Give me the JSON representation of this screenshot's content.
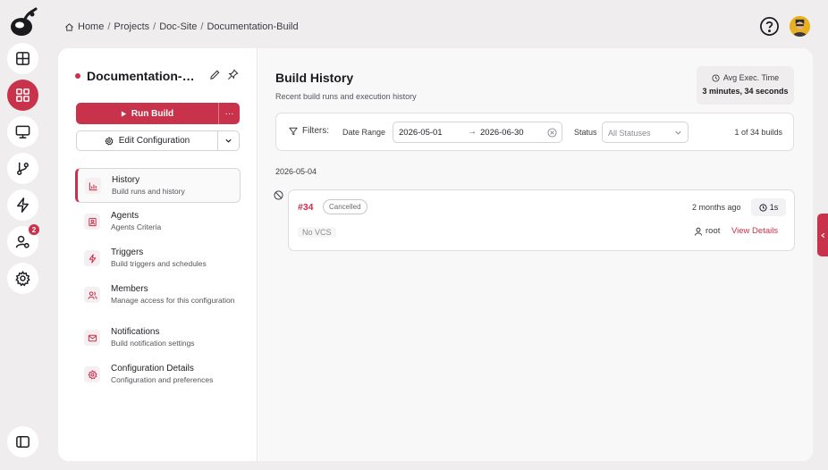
{
  "breadcrumb": {
    "items": [
      "Home",
      "Projects",
      "Doc-Site",
      "Documentation-Build"
    ],
    "separator": "/"
  },
  "rail": {
    "items": [
      {
        "icon": "layout-icon",
        "active": false
      },
      {
        "icon": "grid-icon",
        "active": true
      },
      {
        "icon": "monitor-icon",
        "active": false
      },
      {
        "icon": "git-branch-icon",
        "active": false
      },
      {
        "icon": "zap-icon",
        "active": false
      },
      {
        "icon": "user-cog-icon",
        "active": false,
        "badge": "2"
      },
      {
        "icon": "gear-icon",
        "active": false
      }
    ],
    "bottom_icon": "sidebar-toggle-icon"
  },
  "config": {
    "title": "Documentation-Build",
    "run_label": "Run Build",
    "more_label": "···",
    "edit_label": "Edit Configuration"
  },
  "nav": {
    "items": [
      {
        "label": "History",
        "desc": "Build runs and history",
        "icon": "chart-icon",
        "active": true
      },
      {
        "label": "Agents",
        "desc": "Agents Criteria",
        "icon": "agent-icon"
      },
      {
        "label": "Triggers",
        "desc": "Build triggers and schedules",
        "icon": "zap-icon"
      },
      {
        "label": "Members",
        "desc": "Manage access for this configuration",
        "icon": "users-icon"
      },
      {
        "label": "Notifications",
        "desc": "Build notification settings",
        "icon": "mail-icon"
      },
      {
        "label": "Configuration Details",
        "desc": "Configuration and preferences",
        "icon": "gear-icon"
      }
    ]
  },
  "history": {
    "title": "Build History",
    "subtitle": "Recent build runs and execution history",
    "avg_label": "Avg Exec. Time",
    "avg_value": "3 minutes, 34 seconds"
  },
  "filters": {
    "label": "Filters:",
    "date_range_label": "Date Range",
    "date_start": "2026-05-01",
    "date_arrow": "→",
    "date_end": "2026-06-30",
    "status_label": "Status",
    "status_placeholder": "All Statuses",
    "count": "1 of 34 builds"
  },
  "groups": [
    {
      "date": "2026-05-04",
      "builds": [
        {
          "number": "#34",
          "status": "Cancelled",
          "ago": "2 months ago",
          "duration": "1s",
          "vcs": "No VCS",
          "user": "root",
          "details_label": "View Details"
        }
      ]
    }
  ],
  "colors": {
    "accent": "#c8324b",
    "background": "#efedee",
    "panel": "#ffffff"
  }
}
